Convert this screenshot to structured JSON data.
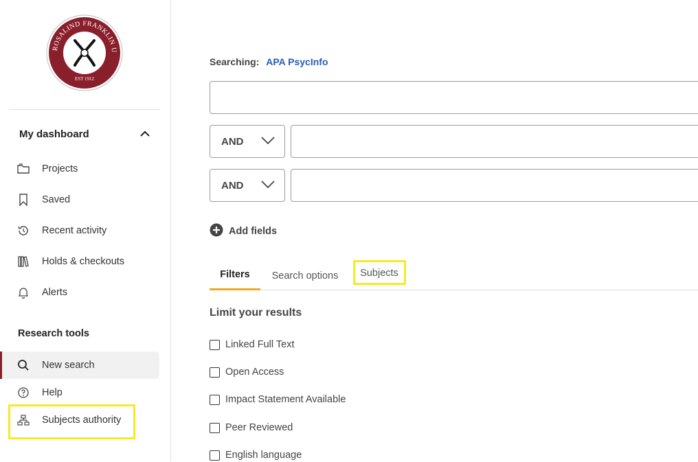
{
  "logo": {
    "university_text": "ROSALIND FRANKLIN UNIVERSITY",
    "established": "EST 1912",
    "colors": {
      "ring": "#8a1f2c",
      "inner": "#ffffff"
    }
  },
  "sidebar": {
    "dashboard": {
      "label": "My dashboard",
      "toggle_icon": "chevron-up-icon"
    },
    "dashboard_items": [
      {
        "label": "Projects",
        "icon": "folder-icon"
      },
      {
        "label": "Saved",
        "icon": "bookmark-icon"
      },
      {
        "label": "Recent activity",
        "icon": "history-icon"
      },
      {
        "label": "Holds & checkouts",
        "icon": "books-icon"
      },
      {
        "label": "Alerts",
        "icon": "bell-icon"
      }
    ],
    "research_tools_title": "Research tools",
    "research_items": [
      {
        "label": "New search",
        "icon": "search-icon",
        "active": true
      },
      {
        "label": "Help",
        "icon": "help-icon"
      },
      {
        "label": "Subjects authority",
        "icon": "hierarchy-icon",
        "highlighted": true
      }
    ]
  },
  "search": {
    "searching_label": "Searching:",
    "database": "APA PsycInfo",
    "main_value": "",
    "rows": [
      {
        "operator": "AND",
        "value": ""
      },
      {
        "operator": "AND",
        "value": ""
      }
    ],
    "add_fields_label": "Add fields"
  },
  "tabs": [
    {
      "label": "Filters",
      "active": true
    },
    {
      "label": "Search options",
      "active": false
    },
    {
      "label": "Subjects",
      "active": false,
      "highlighted": true
    }
  ],
  "filters": {
    "title": "Limit your results",
    "options": [
      {
        "label": "Linked Full Text",
        "checked": false
      },
      {
        "label": "Open Access",
        "checked": false
      },
      {
        "label": "Impact Statement Available",
        "checked": false
      },
      {
        "label": "Peer Reviewed",
        "checked": false
      },
      {
        "label": "English language",
        "checked": false
      }
    ]
  },
  "colors": {
    "accent": "#2a5db0",
    "active_tab": "#f0a81c",
    "highlight": "#f4ea27",
    "brand": "#8a1f2c"
  }
}
